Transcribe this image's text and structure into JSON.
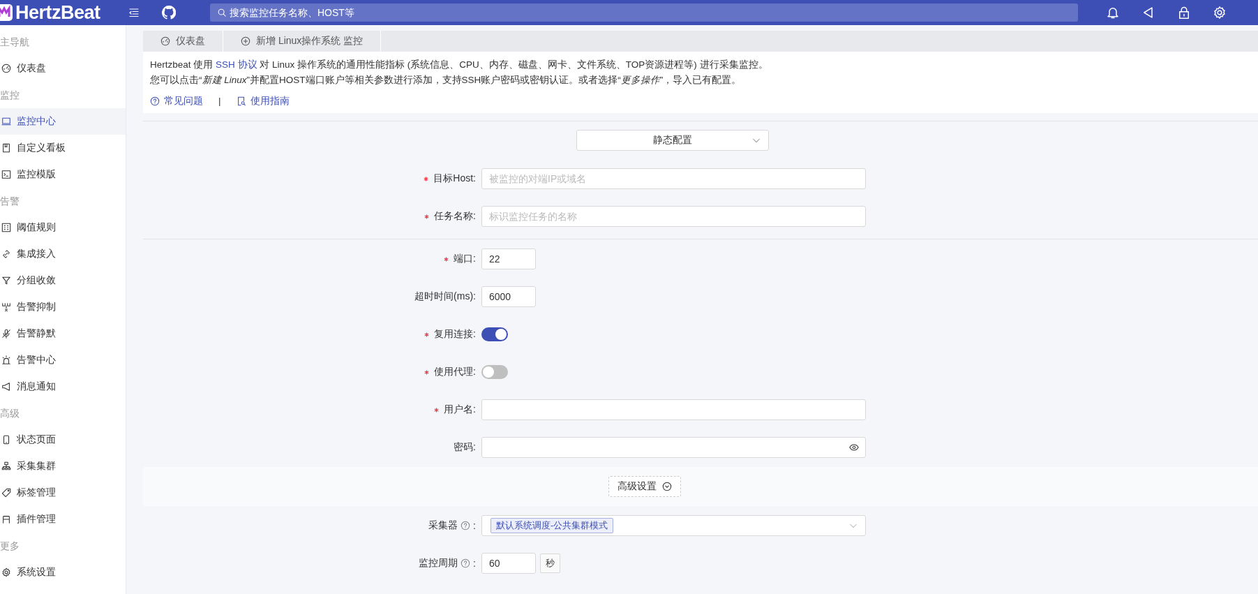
{
  "header": {
    "logo": "HertzBeat",
    "search_placeholder": "搜索监控任务名称、HOST等"
  },
  "sidebar": {
    "groups": [
      {
        "title": "主导航",
        "items": [
          {
            "label": "仪表盘",
            "selected": false
          }
        ]
      },
      {
        "title": "监控",
        "items": [
          {
            "label": "监控中心",
            "selected": true
          },
          {
            "label": "自定义看板",
            "selected": false
          },
          {
            "label": "监控模版",
            "selected": false
          }
        ]
      },
      {
        "title": "告警",
        "items": [
          {
            "label": "阈值规则",
            "selected": false
          },
          {
            "label": "集成接入",
            "selected": false
          },
          {
            "label": "分组收敛",
            "selected": false
          },
          {
            "label": "告警抑制",
            "selected": false
          },
          {
            "label": "告警静默",
            "selected": false
          },
          {
            "label": "告警中心",
            "selected": false
          },
          {
            "label": "消息通知",
            "selected": false
          }
        ]
      },
      {
        "title": "高级",
        "items": [
          {
            "label": "状态页面",
            "selected": false
          },
          {
            "label": "采集集群",
            "selected": false
          },
          {
            "label": "标签管理",
            "selected": false
          },
          {
            "label": "插件管理",
            "selected": false
          }
        ]
      },
      {
        "title": "更多",
        "items": [
          {
            "label": "系统设置",
            "selected": false
          }
        ]
      }
    ]
  },
  "tabs": [
    {
      "label": "仪表盘"
    },
    {
      "label": "新增 Linux操作系统 监控"
    }
  ],
  "intro": {
    "line1_before": "Hertzbeat 使用",
    "line1_link": "SSH 协议",
    "line1_after": "对 Linux 操作系统的通用性能指标 (系统信息、CPU、内存、磁盘、网卡、文件系统、TOP资源进程等) 进行采集监控。",
    "line2": "您可以点击“*新建 Linux*”并配置HOST端口账户等相关参数进行添加，支持SSH账户密码或密钥认证。或者选择“*更多操作*”，导入已有配置。",
    "links": [
      {
        "label": "常见问题"
      },
      {
        "label": "使用指南"
      }
    ],
    "separator": "|"
  },
  "form": {
    "mode": "静态配置",
    "sections": [
      {
        "kind": "fields",
        "fields": [
          {
            "kind": "text",
            "label": "目标Host:",
            "required": true,
            "placeholder": "被监控的对端IP或域名"
          },
          {
            "kind": "text",
            "label": "任务名称:",
            "required": true,
            "placeholder": "标识监控任务的名称"
          }
        ]
      },
      {
        "kind": "fields",
        "fields": [
          {
            "kind": "short",
            "label": "端口:",
            "required": true,
            "value": "22"
          },
          {
            "kind": "short",
            "label": "超时时间(ms):",
            "required": false,
            "value": "6000"
          },
          {
            "kind": "switch",
            "label": "复用连接:",
            "required": true,
            "on": true
          },
          {
            "kind": "switch",
            "label": "使用代理:",
            "required": true,
            "on": false
          },
          {
            "kind": "text",
            "label": "用户名:",
            "required": true
          },
          {
            "kind": "password",
            "label": "密码:",
            "required": false
          }
        ]
      },
      {
        "kind": "toggle",
        "label": "高级设置"
      },
      {
        "kind": "fields",
        "fields": [
          {
            "kind": "select",
            "label": "采集器 :",
            "required": false,
            "help": true,
            "tag": "默认系统调度-公共集群模式"
          },
          {
            "kind": "unit",
            "label": "监控周期 :",
            "required": false,
            "help": true,
            "value": "60",
            "unit": "秒"
          }
        ]
      }
    ]
  }
}
